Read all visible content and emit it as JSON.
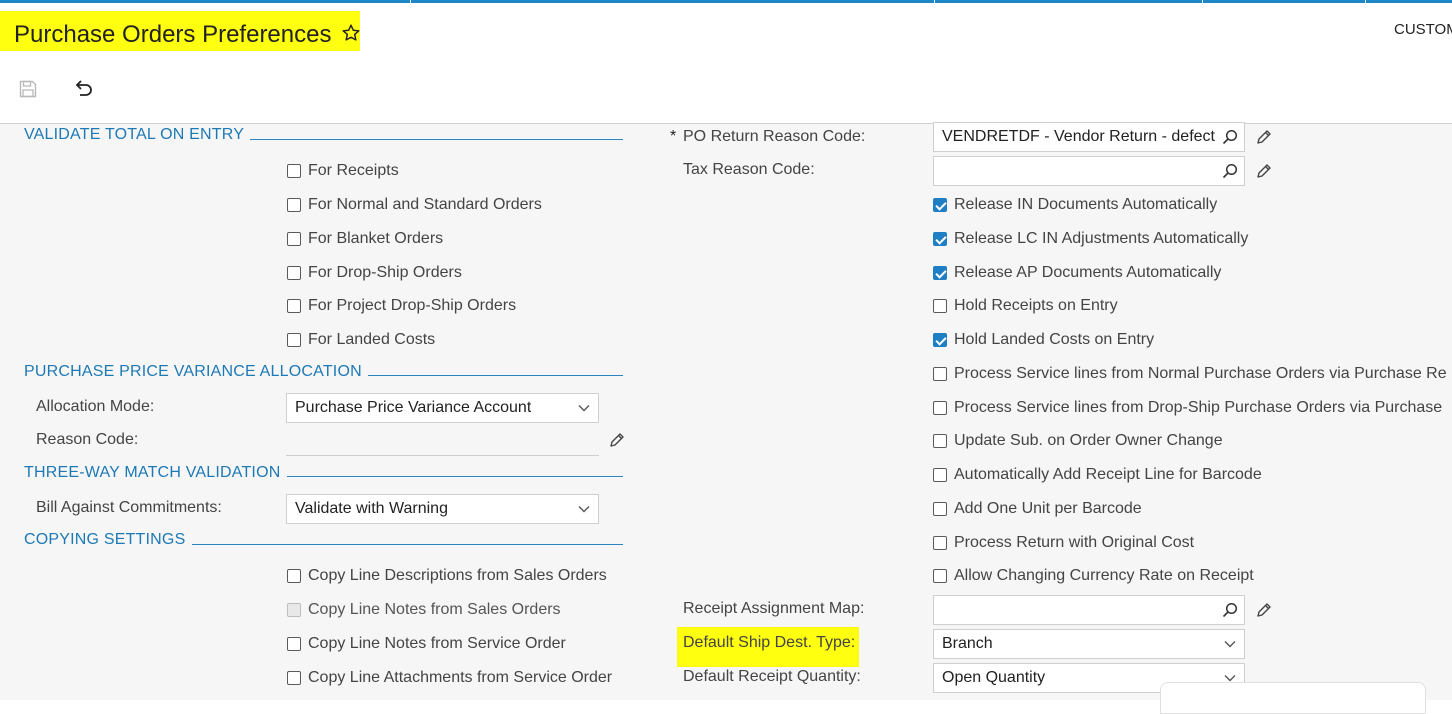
{
  "header": {
    "title": "Purchase Orders Preferences",
    "customization_label": "CUSTOM"
  },
  "toolbar": {
    "save_icon": "save-icon",
    "undo_icon": "undo-icon"
  },
  "sections": {
    "validate_total": "VALIDATE TOTAL ON ENTRY",
    "ppv_allocation": "PURCHASE PRICE VARIANCE ALLOCATION",
    "three_way": "THREE-WAY MATCH VALIDATION",
    "copying": "COPYING SETTINGS"
  },
  "validate_total": {
    "receipts": "For Receipts",
    "normal_standard": "For Normal and Standard Orders",
    "blanket": "For Blanket Orders",
    "drop_ship": "For Drop-Ship Orders",
    "project_drop_ship": "For Project Drop-Ship Orders",
    "landed_costs": "For Landed Costs"
  },
  "ppv": {
    "allocation_mode_label": "Allocation Mode:",
    "allocation_mode_value": "Purchase Price Variance Account",
    "reason_code_label": "Reason Code:"
  },
  "three_way": {
    "bill_against_label": "Bill Against Commitments:",
    "bill_against_value": "Validate with Warning"
  },
  "copying": {
    "line_desc_sales": "Copy Line Descriptions from Sales Orders",
    "line_notes_sales": "Copy Line Notes from Sales Orders",
    "line_notes_service": "Copy Line Notes from Service Order",
    "line_attach_service": "Copy Line Attachments from Service Order"
  },
  "right": {
    "required_mark": "*",
    "po_return_label": "PO Return Reason Code:",
    "po_return_value": "VENDRETDF - Vendor Return - defect",
    "tax_reason_label": "Tax Reason Code:",
    "tax_reason_value": "",
    "release_in": "Release IN Documents Automatically",
    "release_lc": "Release LC IN Adjustments Automatically",
    "release_ap": "Release AP Documents Automatically",
    "hold_receipts": "Hold Receipts on Entry",
    "hold_landed": "Hold Landed Costs on Entry",
    "process_service_normal": "Process Service lines from Normal Purchase Orders via Purchase Re",
    "process_service_dropship": "Process Service lines from Drop-Ship Purchase Orders via Purchase",
    "update_sub": "Update Sub. on Order Owner Change",
    "auto_add_receipt": "Automatically Add Receipt Line for Barcode",
    "add_one_unit": "Add One Unit per Barcode",
    "process_return": "Process Return with Original Cost",
    "allow_currency": "Allow Changing Currency Rate on Receipt",
    "receipt_map_label": "Receipt Assignment Map:",
    "receipt_map_value": "",
    "ship_dest_label": "Default Ship Dest. Type:",
    "ship_dest_value": "Branch",
    "receipt_qty_label": "Default Receipt Quantity:",
    "receipt_qty_value": "Open Quantity"
  },
  "colors": {
    "accent": "#1d79b5",
    "highlight": "#ffff10",
    "checkbox_checked": "#1f7fc4"
  }
}
